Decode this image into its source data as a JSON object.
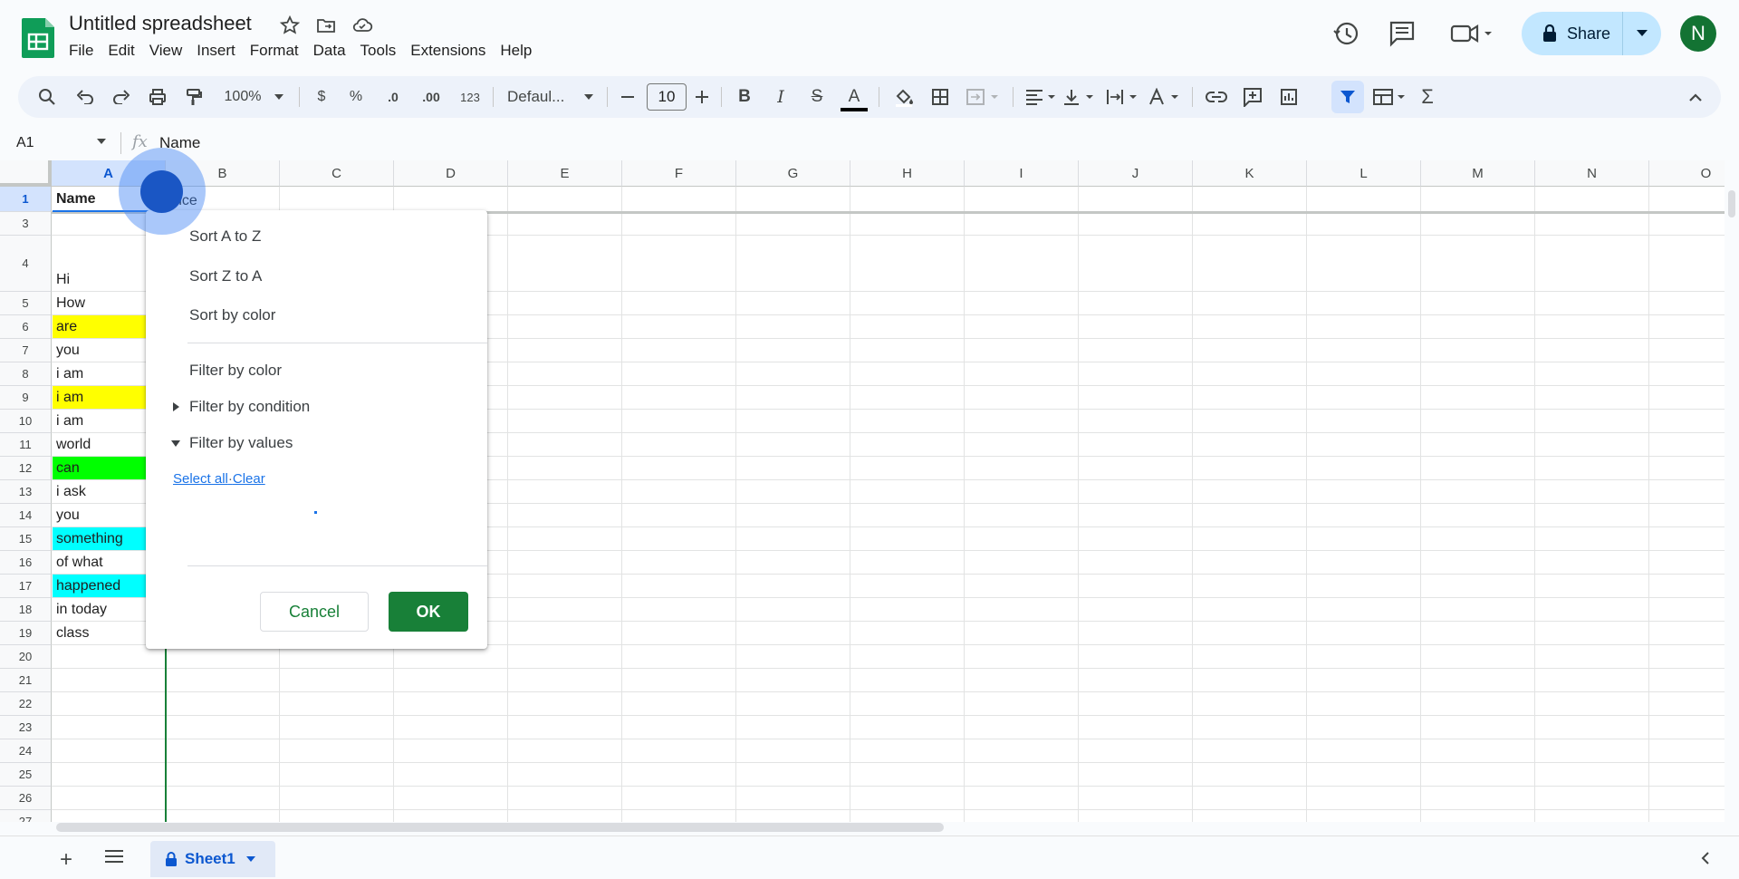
{
  "app": {
    "title": "Untitled spreadsheet",
    "menu": [
      "File",
      "Edit",
      "View",
      "Insert",
      "Format",
      "Data",
      "Tools",
      "Extensions",
      "Help"
    ],
    "share_label": "Share",
    "avatar_letter": "N"
  },
  "toolbar": {
    "zoom": "100%",
    "currency": "$",
    "percent": "%",
    "decrease_decimal": ".0",
    "increase_decimal": ".00",
    "number_format": "123",
    "font": "Defaul...",
    "font_size": "10",
    "bold": "B",
    "italic": "I",
    "strike": "S",
    "text_color": "A",
    "sum": "Σ"
  },
  "formula_bar": {
    "cell_ref": "A1",
    "fx": "fx",
    "value": "Name"
  },
  "grid": {
    "columns": [
      "A",
      "B",
      "C",
      "D",
      "E",
      "F",
      "G",
      "H",
      "I",
      "J",
      "K",
      "L",
      "M",
      "N",
      "O"
    ],
    "rows": [
      "1",
      "3",
      "4",
      "5",
      "6",
      "7",
      "8",
      "9",
      "10",
      "11",
      "12",
      "13",
      "14",
      "15",
      "16",
      "17",
      "18",
      "19",
      "20",
      "21",
      "22",
      "23",
      "24",
      "25",
      "26",
      "27"
    ],
    "header_a1": "Name",
    "header_b1": "rice",
    "cells": [
      {
        "row": "4",
        "value": "Hi",
        "bg": ""
      },
      {
        "row": "5",
        "value": "How",
        "bg": ""
      },
      {
        "row": "6",
        "value": "are",
        "bg": "#ffff00"
      },
      {
        "row": "7",
        "value": "you",
        "bg": ""
      },
      {
        "row": "8",
        "value": "i am",
        "bg": ""
      },
      {
        "row": "9",
        "value": "i am",
        "bg": "#ffff00"
      },
      {
        "row": "10",
        "value": "i am",
        "bg": ""
      },
      {
        "row": "11",
        "value": "world",
        "bg": ""
      },
      {
        "row": "12",
        "value": "can",
        "bg": "#00ff00"
      },
      {
        "row": "13",
        "value": "i ask",
        "bg": ""
      },
      {
        "row": "14",
        "value": "you",
        "bg": ""
      },
      {
        "row": "15",
        "value": "something",
        "bg": "#00ffff"
      },
      {
        "row": "16",
        "value": "of what",
        "bg": ""
      },
      {
        "row": "17",
        "value": "happened",
        "bg": "#00ffff"
      },
      {
        "row": "18",
        "value": "in today",
        "bg": ""
      },
      {
        "row": "19",
        "value": "class",
        "bg": ""
      }
    ]
  },
  "filter_menu": {
    "sort_az": "Sort A to Z",
    "sort_za": "Sort Z to A",
    "sort_color": "Sort by color",
    "filter_color": "Filter by color",
    "filter_condition": "Filter by condition",
    "filter_values": "Filter by values",
    "select_all": "Select all",
    "dot": "·",
    "clear": "Clear",
    "cancel": "Cancel",
    "ok": "OK"
  },
  "sheet": {
    "add": "+",
    "tab_name": "Sheet1"
  },
  "colors": {
    "accent": "#0b57d0",
    "ok_green": "#188038",
    "share_bg": "#c2e7ff",
    "selected_header": "#d3e3fd"
  }
}
